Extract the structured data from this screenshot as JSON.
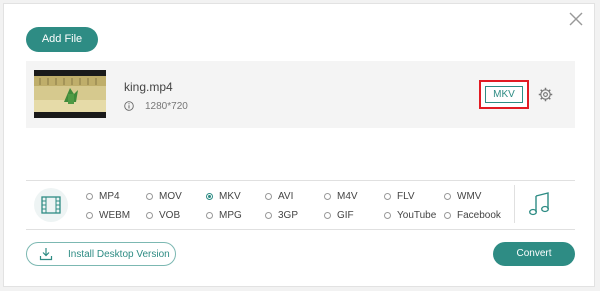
{
  "toolbar": {
    "add_file_label": "Add File"
  },
  "file": {
    "name": "king.mp4",
    "resolution": "1280*720",
    "output_format": "MKV"
  },
  "formats": {
    "row1": [
      "MP4",
      "MOV",
      "MKV",
      "AVI",
      "M4V",
      "FLV",
      "WMV"
    ],
    "row2": [
      "WEBM",
      "VOB",
      "MPG",
      "3GP",
      "GIF",
      "YouTube",
      "Facebook"
    ],
    "selected": "MKV"
  },
  "footer": {
    "install_label": "Install Desktop Version",
    "convert_label": "Convert"
  },
  "colors": {
    "accent": "#2e8c84",
    "highlight": "#e21b23"
  }
}
